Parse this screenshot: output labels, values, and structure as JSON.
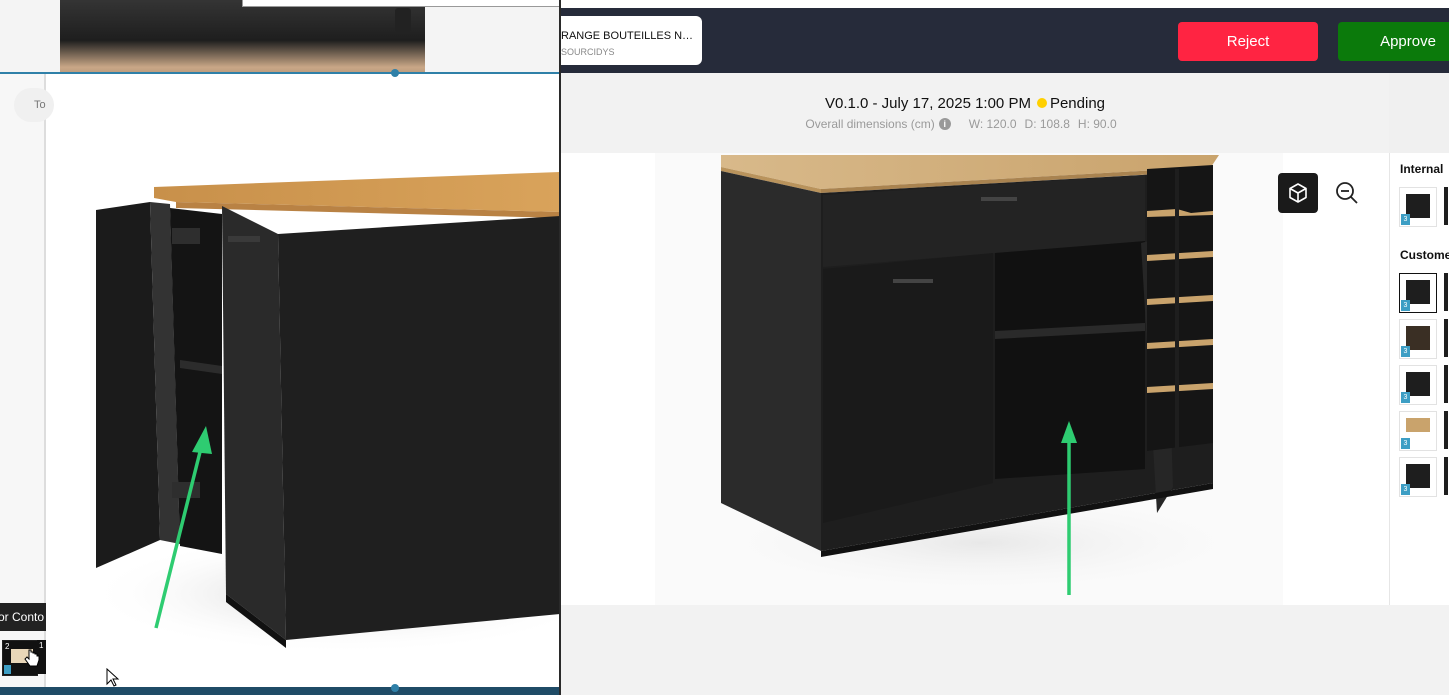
{
  "header": {
    "product_title": "RANGE BOUTEILLES NO...",
    "product_subtitle": "SOURCIDYS",
    "reject_label": "Reject",
    "approve_label": "Approve"
  },
  "version": {
    "label": "V0.1.0 - July 17, 2025 1:00 PM",
    "status": "Pending",
    "status_color": "#ffd000",
    "dims_label": "Overall dimensions (cm)",
    "width": "W: 120.0",
    "depth": "D: 108.8",
    "height": "H: 90.0"
  },
  "side_panel": {
    "internal_label": "Internal",
    "custom_label": "Custome"
  },
  "left_pane": {
    "search_placeholder": "To",
    "tooltip": "or Conto",
    "thumb_number_a": "2",
    "thumb_number_b": "1"
  },
  "colors": {
    "reject": "#ff2442",
    "approve": "#0b7a0b",
    "header_bg": "#262b3a",
    "arrow": "#2ecc71"
  }
}
